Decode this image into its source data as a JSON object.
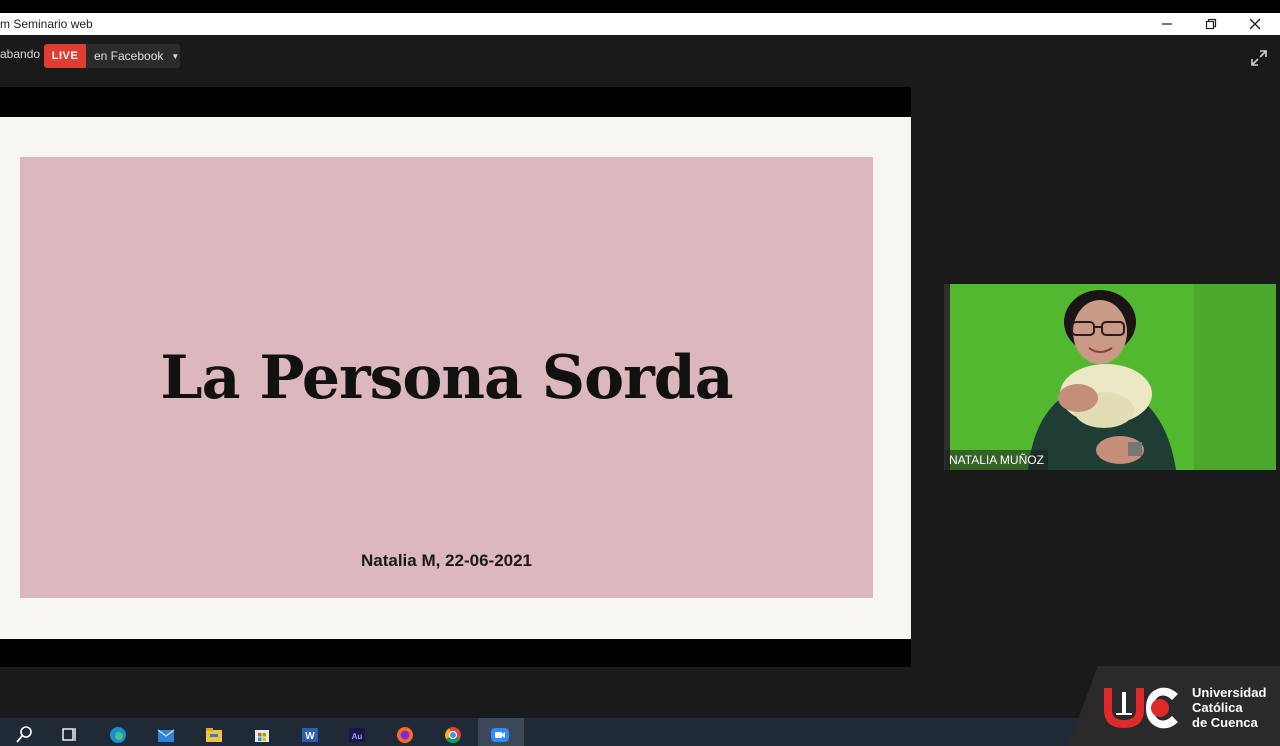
{
  "window": {
    "title": "m Seminario web"
  },
  "toolbar": {
    "recording_label": "abando",
    "live_badge": "LIVE",
    "stream_target": "en Facebook"
  },
  "slide": {
    "title": "La Persona Sorda",
    "subtitle": "Natalia M, 22-06-2021"
  },
  "participant": {
    "name": "NATALIA MUÑOZ"
  },
  "logo": {
    "line1": "Universidad",
    "line2": "Católica",
    "line3": "de Cuenca"
  },
  "taskbar": {
    "icons": [
      "search-icon",
      "task-view-icon",
      "edge-icon",
      "mail-icon",
      "file-explorer-icon",
      "store-icon",
      "word-icon",
      "audition-icon",
      "firefox-icon",
      "chrome-icon",
      "zoom-icon"
    ]
  },
  "colors": {
    "live_red": "#e03c31",
    "slide_pink": "#dcb7be",
    "app_background": "#1a1a1a",
    "green_screen": "#4fb52e",
    "logo_red": "#e02a2a"
  }
}
